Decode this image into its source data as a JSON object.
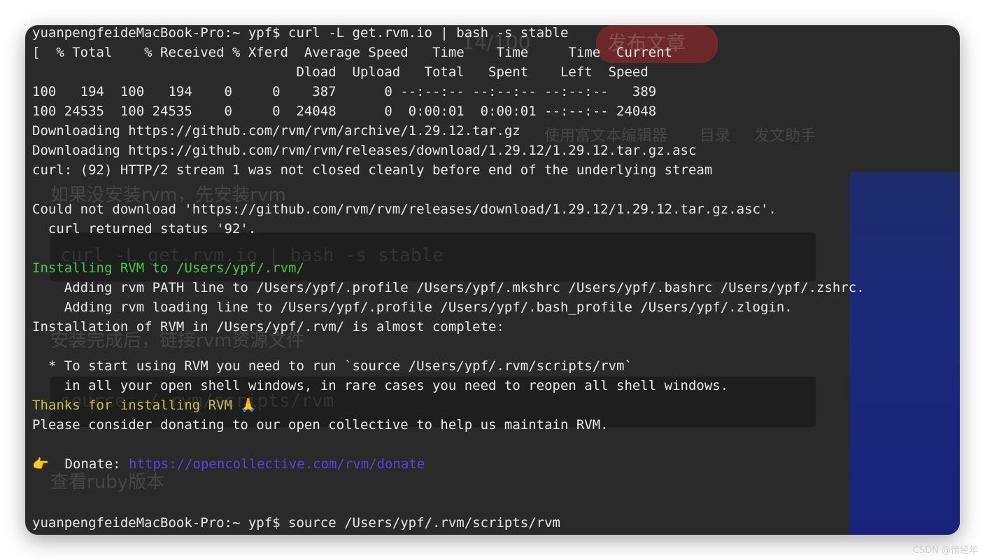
{
  "terminal": {
    "lines": [
      {
        "text": "yuanpengfeideMacBook-Pro:~ ypf$ curl -L get.rvm.io | bash -s stable",
        "color": "default"
      },
      {
        "text": "[  % Total    % Received % Xferd  Average Speed   Time    Time     Time  Current",
        "color": "default"
      },
      {
        "text": "                                 Dload  Upload   Total   Spent    Left  Speed",
        "color": "default"
      },
      {
        "text": "100   194  100   194    0     0    387      0 --:--:-- --:--:-- --:--:--   389",
        "color": "default"
      },
      {
        "text": "100 24535  100 24535    0     0  24048      0  0:00:01  0:00:01 --:--:-- 24048",
        "color": "default"
      },
      {
        "text": "Downloading https://github.com/rvm/rvm/archive/1.29.12.tar.gz",
        "color": "default"
      },
      {
        "text": "Downloading https://github.com/rvm/rvm/releases/download/1.29.12/1.29.12.tar.gz.asc",
        "color": "default"
      },
      {
        "text": "curl: (92) HTTP/2 stream 1 was not closed cleanly before end of the underlying stream",
        "color": "default"
      },
      {
        "text": "",
        "color": "default"
      },
      {
        "text": "Could not download 'https://github.com/rvm/rvm/releases/download/1.29.12/1.29.12.tar.gz.asc'.",
        "color": "default"
      },
      {
        "text": "  curl returned status '92'.",
        "color": "default"
      },
      {
        "text": "",
        "color": "default"
      },
      {
        "text": "Installing RVM to /Users/ypf/.rvm/",
        "color": "green"
      },
      {
        "text": "    Adding rvm PATH line to /Users/ypf/.profile /Users/ypf/.mkshrc /Users/ypf/.bashrc /Users/ypf/.zshrc.",
        "color": "default"
      },
      {
        "text": "    Adding rvm loading line to /Users/ypf/.profile /Users/ypf/.bash_profile /Users/ypf/.zlogin.",
        "color": "default"
      },
      {
        "text": "Installation of RVM in /Users/ypf/.rvm/ is almost complete:",
        "color": "default"
      },
      {
        "text": "",
        "color": "default"
      },
      {
        "text": "  * To start using RVM you need to run `source /Users/ypf/.rvm/scripts/rvm`",
        "color": "default"
      },
      {
        "text": "    in all your open shell windows, in rare cases you need to reopen all shell windows.",
        "color": "default"
      },
      {
        "text": "Thanks for installing RVM 🙏",
        "color": "yellow"
      },
      {
        "text": "Please consider donating to our open collective to help us maintain RVM.",
        "color": "default"
      },
      {
        "text": "",
        "color": "default"
      },
      {
        "text": "👉  Donate: ",
        "color": "default",
        "link": "https://opencollective.com/rvm/donate"
      },
      {
        "text": "",
        "color": "default"
      },
      {
        "text": "",
        "color": "default"
      },
      {
        "text": "yuanpengfeideMacBook-Pro:~ ypf$ source /Users/ypf/.rvm/scripts/rvm",
        "color": "default"
      }
    ]
  },
  "background_page": {
    "publish_button": "发布文章",
    "counter": "14/100",
    "toolbar_items": [
      "使用富文本编辑器",
      "目录",
      "发文助手"
    ],
    "heading_1": "如果没安装rvm，先安装rvm",
    "code_1": "curl -L get.rvm.io | bash -s stable",
    "heading_2": "安装完成后，链接rvm资源文件",
    "code_2": "source ~/.rvm/scripts/rvm",
    "heading_3": "查看ruby版本"
  },
  "watermark": "CSDN @惜经年",
  "colors": {
    "terminal_bg": "#2a2a2a",
    "text": "#e9e9e9",
    "green": "#4bc64b",
    "yellow": "#c7c24a",
    "link": "#5e3fe0"
  }
}
